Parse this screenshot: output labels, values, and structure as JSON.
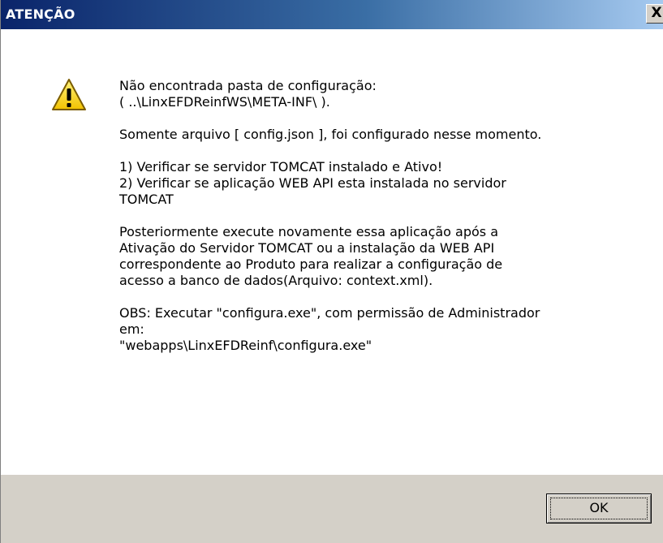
{
  "window": {
    "title": "ATENÇÃO",
    "close_label": "X"
  },
  "icon": "warning-icon",
  "message": {
    "line1": "Não encontrada pasta de configuração:",
    "line2": "( ..\\LinxEFDReinfWS\\META-INF\\ ).",
    "line3": "Somente arquivo [ config.json ], foi configurado nesse momento.",
    "line4": "1) Verificar se servidor TOMCAT instalado e Ativo!",
    "line5": "2) Verificar se aplicação WEB API esta instalada no servidor",
    "line6": "TOMCAT",
    "line7": "Posteriormente execute novamente essa aplicação após a",
    "line8": "Ativação do Servidor TOMCAT ou a instalação da WEB API",
    "line9": "correspondente ao Produto para realizar a configuração de",
    "line10": "acesso a banco de dados(Arquivo: context.xml).",
    "line11": "OBS: Executar \"configura.exe\", com permissão de Administrador",
    "line12": "em:",
    "line13": "\"webapps\\LinxEFDReinf\\configura.exe\""
  },
  "buttons": {
    "ok_label": "OK"
  },
  "colors": {
    "titlebar_start": "#0a246a",
    "titlebar_end": "#a6caf0",
    "button_face": "#d4d0c8",
    "warning_yellow": "#f5d300"
  }
}
